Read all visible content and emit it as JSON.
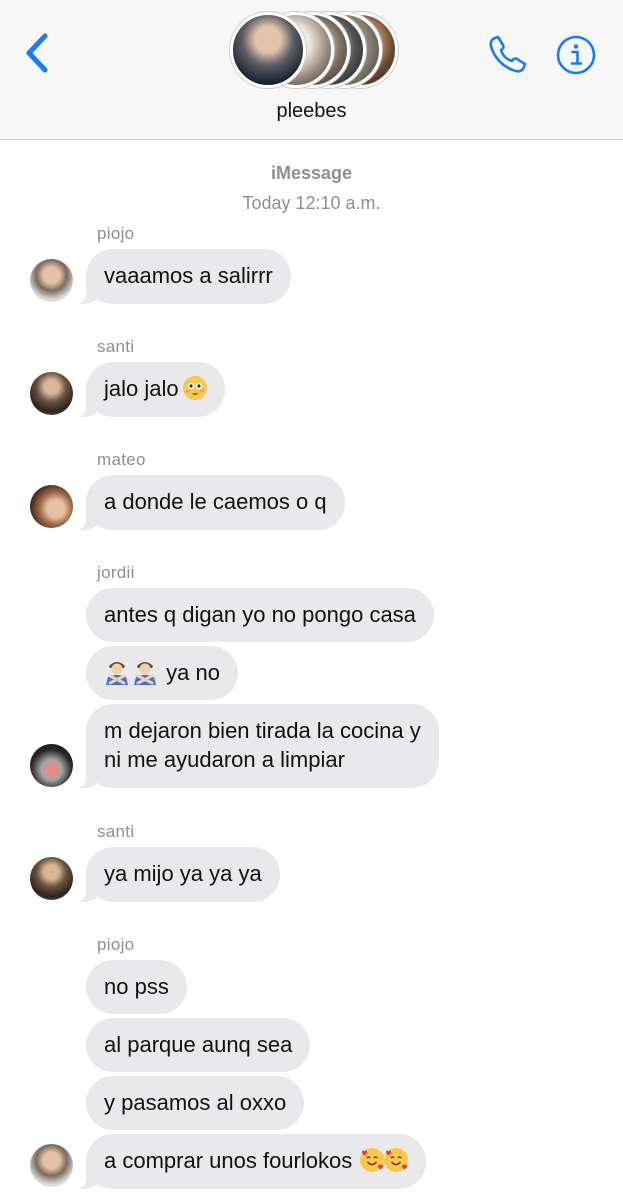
{
  "header": {
    "group_name": "pleebes",
    "accent_color": "#1a7cf0"
  },
  "conversation": {
    "service": "iMessage",
    "timestamp": "Today 12:10 a.m."
  },
  "messages": [
    {
      "sender": "piojo",
      "text": "vaaamos a salirrr"
    },
    {
      "sender": "santi",
      "text": "jalo jalo",
      "emoji": "flushed-face"
    },
    {
      "sender": "mateo",
      "text": "a donde le caemos o q"
    },
    {
      "sender": "jordii",
      "text": "antes q digan yo no pongo casa"
    },
    {
      "sender": "",
      "text": "ya no",
      "emoji": "man-gesturing-no x2"
    },
    {
      "sender": "",
      "text_line1": "m dejaron bien tirada la cocina y",
      "text_line2": "ni me ayudaron a limpiar"
    },
    {
      "sender": "santi",
      "text": "ya mijo ya ya ya"
    },
    {
      "sender": "piojo",
      "text": "no pss"
    },
    {
      "sender": "",
      "text": "al parque aunq sea"
    },
    {
      "sender": "",
      "text": "y pasamos al oxxo"
    },
    {
      "sender": "",
      "text": "a comprar unos fourlokos",
      "emoji": "smiling-face-with-hearts x2"
    }
  ],
  "bubble_color": "#e9e9eb",
  "meta_text_color": "#8e8e93"
}
